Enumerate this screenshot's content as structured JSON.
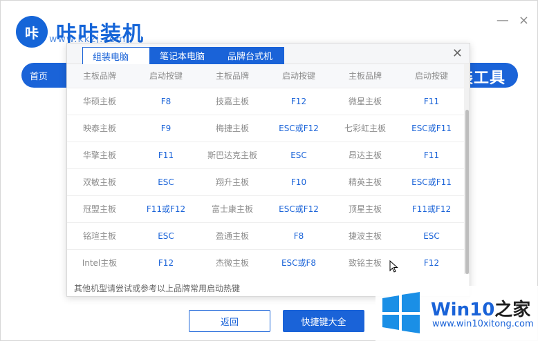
{
  "app": {
    "logo_glyph": "咔",
    "title": "咔咔装机",
    "subtitle": "www.kkzj.com",
    "nav_home": "首页",
    "nav_tool": "装工具",
    "minimize": "—",
    "close": "×",
    "back_label": "返回",
    "quick_label": "快捷键大全",
    "brand_color": "#1a63d8"
  },
  "modal": {
    "tabs": [
      {
        "label": "组装电脑"
      },
      {
        "label": "笔记本电脑"
      },
      {
        "label": "品牌台式机"
      }
    ],
    "close": "✕",
    "headers": [
      "主板品牌",
      "启动按键",
      "主板品牌",
      "启动按键",
      "主板品牌",
      "启动按键"
    ],
    "rows": [
      [
        "华硕主板",
        "F8",
        "技嘉主板",
        "F12",
        "微星主板",
        "F11"
      ],
      [
        "映泰主板",
        "F9",
        "梅捷主板",
        "ESC或F12",
        "七彩虹主板",
        "ESC或F11"
      ],
      [
        "华擎主板",
        "F11",
        "斯巴达克主板",
        "ESC",
        "昂达主板",
        "F11"
      ],
      [
        "双敏主板",
        "ESC",
        "翔升主板",
        "F10",
        "精英主板",
        "ESC或F11"
      ],
      [
        "冠盟主板",
        "F11或F12",
        "富士康主板",
        "ESC或F12",
        "顶星主板",
        "F11或F12"
      ],
      [
        "铭瑄主板",
        "ESC",
        "盈通主板",
        "F8",
        "捷波主板",
        "ESC"
      ],
      [
        "Intel主板",
        "F12",
        "杰微主板",
        "ESC或F8",
        "致铭主板",
        "F12"
      ]
    ],
    "footnote": "其他机型请尝试或参考以上品牌常用启动热键"
  },
  "watermark": {
    "title_prefix": "Win10",
    "title_suffix": "之家",
    "url": "www.win10xitong.com"
  }
}
